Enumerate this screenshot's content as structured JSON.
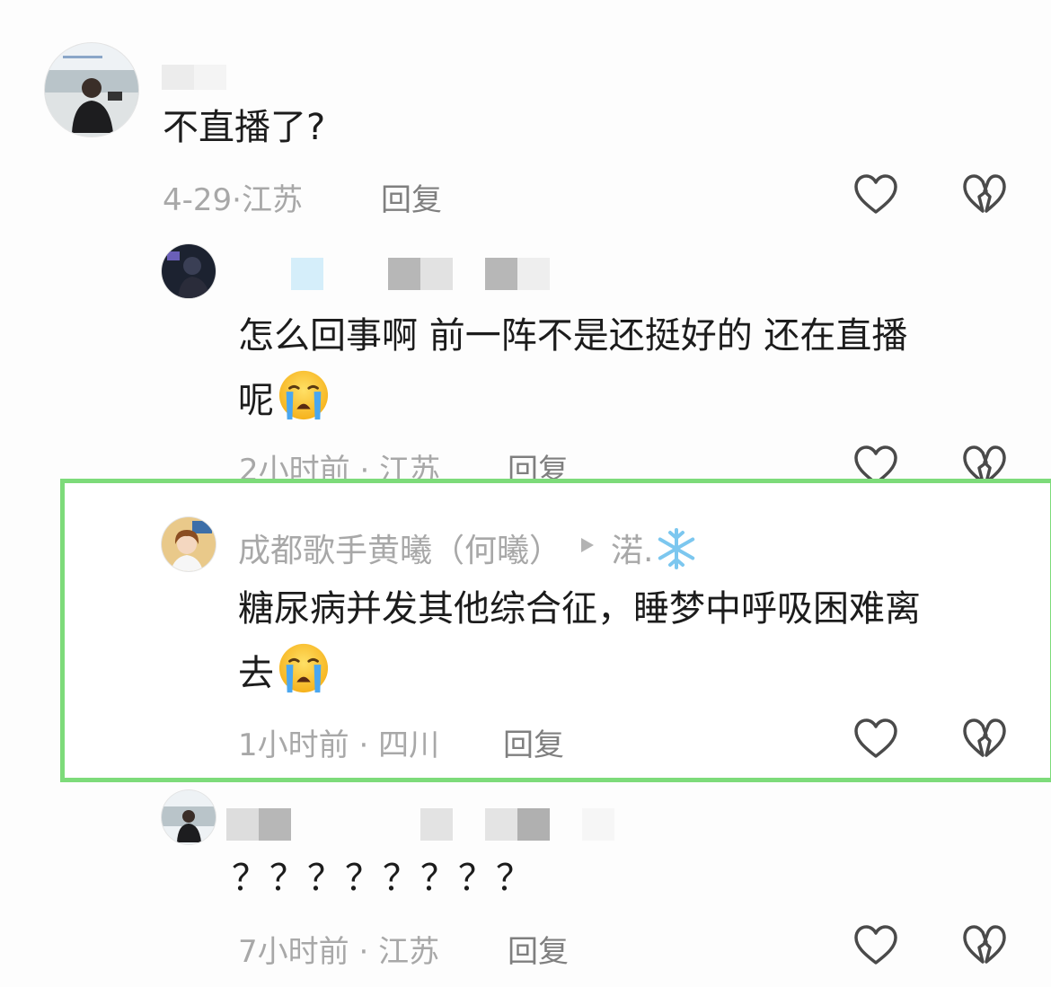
{
  "comments": [
    {
      "text": "不直播了?",
      "time": "4-29",
      "sep": "·",
      "location": "江苏",
      "reply_label": "回复"
    },
    {
      "text_line1": "怎么回事啊  前一阵不是还挺好的  还在直播",
      "text_line2": "呢",
      "time": "2小时前",
      "sep": " · ",
      "location": "江苏",
      "reply_label": "回复"
    },
    {
      "username": "成都歌手黄曦（何曦）",
      "reply_to": "渃.",
      "text_line1": "糖尿病并发其他综合征，睡梦中呼吸困难离",
      "text_line2": "去",
      "time": "1小时前",
      "sep": " · ",
      "location": "四川",
      "reply_label": "回复"
    },
    {
      "text": "？？？？？？？？",
      "time": "7小时前",
      "sep": " · ",
      "location": "江苏",
      "reply_label": "回复"
    }
  ],
  "icons": {
    "like": "heart-outline-icon",
    "dislike": "broken-heart-icon",
    "emoji": "loudly-crying-face-emoji",
    "reply_arrow": "triangle-right-icon",
    "snowflake": "snowflake-emoji"
  },
  "colors": {
    "highlight_border": "#7ddb7a",
    "meta_text": "#a8a8a8",
    "reply_text": "#7f7f7f",
    "icon_stroke": "#4a4a4a"
  }
}
